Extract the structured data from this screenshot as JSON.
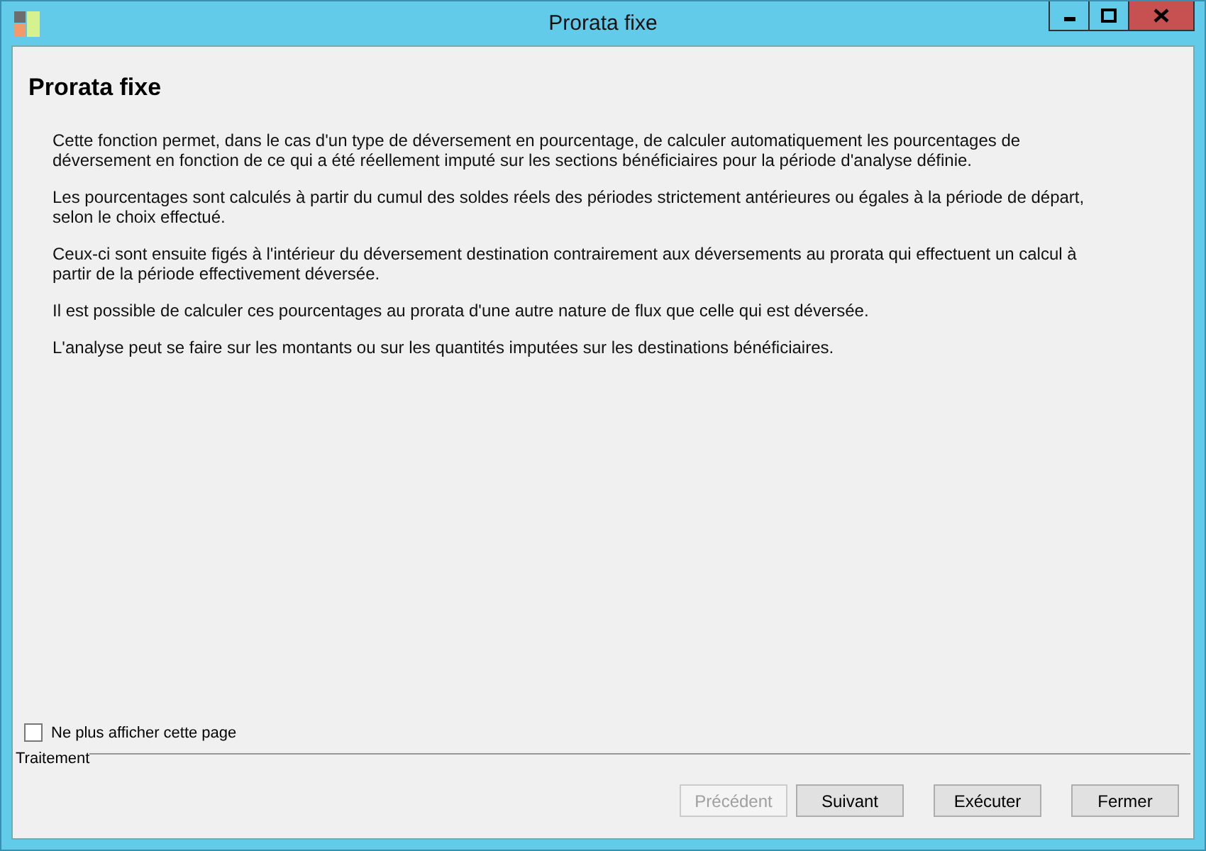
{
  "window": {
    "title": "Prorata fixe"
  },
  "page": {
    "heading": "Prorata fixe",
    "paragraphs": [
      "Cette fonction permet, dans le cas d'un type de déversement en pourcentage, de calculer automatiquement les pourcentages de déversement en fonction de ce qui a été réellement imputé sur les sections bénéficiaires pour la période d'analyse définie.",
      "Les pourcentages sont calculés à partir du cumul des soldes réels des périodes strictement antérieures ou égales à la période de départ, selon le choix effectué.",
      "Ceux-ci sont ensuite figés à l'intérieur du déversement destination contrairement aux déversements au prorata qui effectuent un calcul à partir de la période effectivement déversée.",
      "Il est possible de calculer ces pourcentages au prorata d'une autre nature de flux que celle qui est déversée.",
      "L'analyse peut se faire sur les montants ou sur les quantités imputées sur les destinations bénéficiaires."
    ]
  },
  "dont_show_again": {
    "label": "Ne plus afficher cette page",
    "checked": false
  },
  "group": {
    "label": "Traitement"
  },
  "buttons": [
    {
      "label": "Précédent",
      "disabled": true
    },
    {
      "label": "Suivant",
      "disabled": false
    },
    {
      "label": "Exécuter",
      "disabled": false
    },
    {
      "label": "Fermer",
      "disabled": false
    }
  ]
}
